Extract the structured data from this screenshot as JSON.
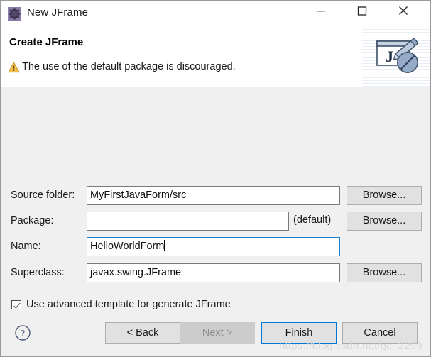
{
  "window": {
    "title": "New JFrame",
    "icon": "jframe-gear-icon",
    "controls": {
      "minimize": "minimize-icon",
      "maximize": "maximize-icon",
      "close": "close-icon"
    }
  },
  "header": {
    "title": "Create JFrame",
    "message": "The use of the default package is discouraged.",
    "message_icon": "warning-icon",
    "banner_icon": "jframe-wizard-banner-icon"
  },
  "form": {
    "rows": [
      {
        "label": "Source folder:",
        "value": "MyFirstJavaForm/src",
        "placeholder": "",
        "focused": false,
        "browse_label": "Browse..."
      },
      {
        "label": "Package:",
        "value": "",
        "placeholder": "",
        "focused": false,
        "suffix": "(default)",
        "browse_label": "Browse..."
      },
      {
        "label": "Name:",
        "value": "HelloWorldForm",
        "placeholder": "",
        "focused": true
      },
      {
        "label": "Superclass:",
        "value": "javax.swing.JFrame",
        "placeholder": "",
        "focused": false,
        "browse_label": "Browse..."
      }
    ],
    "checkbox": {
      "label": "Use advanced template for generate JFrame",
      "checked": true
    }
  },
  "footer": {
    "help_icon": "help-question-icon",
    "buttons": {
      "back": "< Back",
      "next": "Next >",
      "finish": "Finish",
      "cancel": "Cancel"
    },
    "next_enabled": false,
    "default_button": "Finish"
  },
  "watermark": "https://blog.csdn.net/gc_2299",
  "colors": {
    "accent": "#0078d7",
    "dialog_bg": "#f0f0f0",
    "header_bg": "#ffffff",
    "field_border": "#7a7a7a",
    "focus_border": "#1a7fd4",
    "disabled_text": "#8e8e8e",
    "title_icon_bg": "#8a7ba8",
    "warning": "#f0b429"
  }
}
